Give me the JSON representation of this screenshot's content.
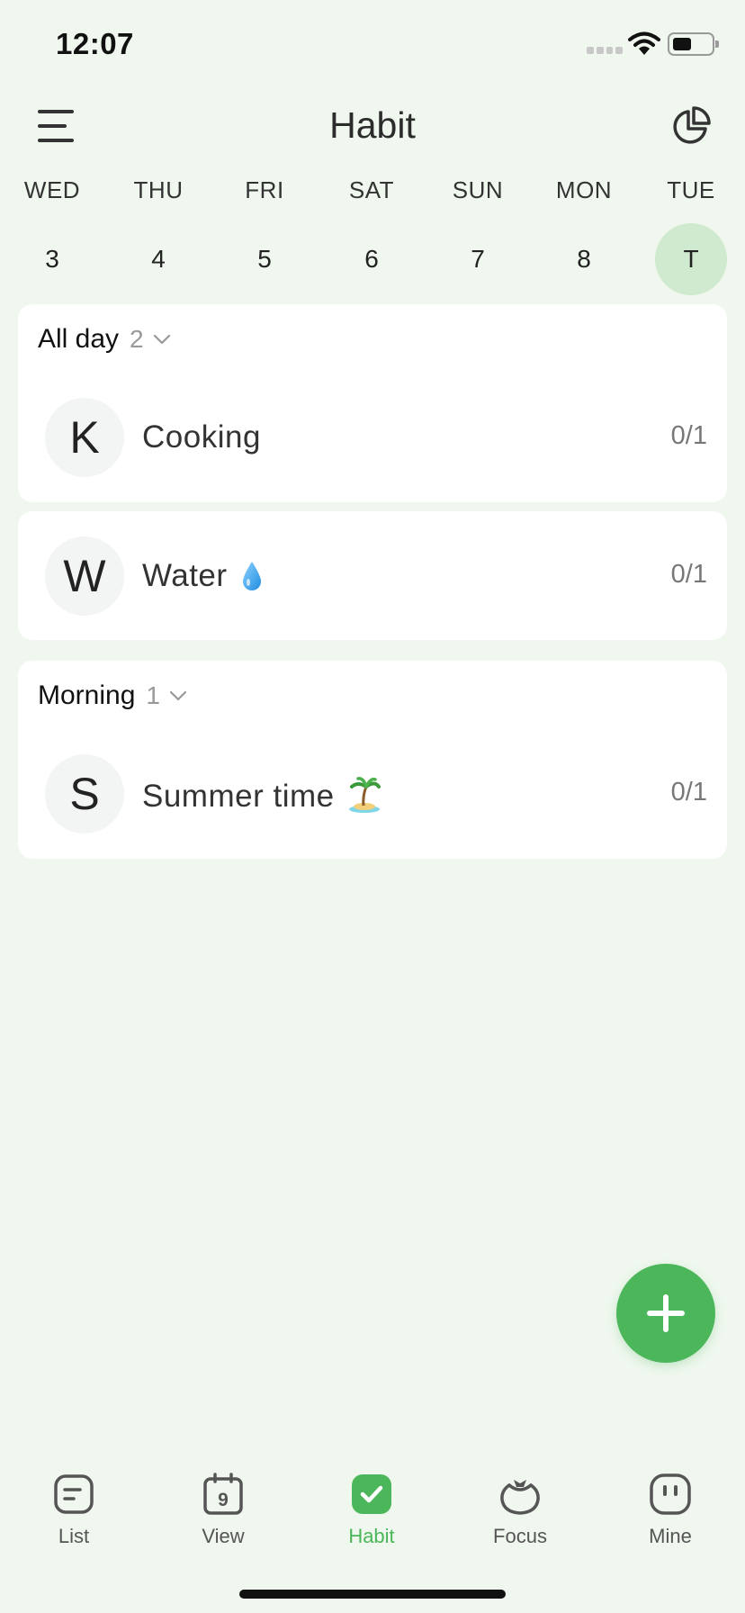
{
  "status_bar": {
    "time": "12:07"
  },
  "header": {
    "title": "Habit"
  },
  "week": {
    "days": [
      {
        "name": "WED",
        "num": "3",
        "selected": false
      },
      {
        "name": "THU",
        "num": "4",
        "selected": false
      },
      {
        "name": "FRI",
        "num": "5",
        "selected": false
      },
      {
        "name": "SAT",
        "num": "6",
        "selected": false
      },
      {
        "name": "SUN",
        "num": "7",
        "selected": false
      },
      {
        "name": "MON",
        "num": "8",
        "selected": false
      },
      {
        "name": "TUE",
        "num": "T",
        "selected": true
      }
    ]
  },
  "sections": [
    {
      "title": "All day",
      "count": "2",
      "habits": [
        {
          "initial": "K",
          "name": "Cooking",
          "progress": "0/1"
        },
        {
          "initial": "W",
          "name": "Water",
          "progress": "0/1",
          "emoji_icon": "water-drop"
        }
      ]
    },
    {
      "title": "Morning",
      "count": "1",
      "habits": [
        {
          "initial": "S",
          "name": "Summer time",
          "progress": "0/1",
          "emoji_icon": "desert-island"
        }
      ]
    }
  ],
  "tabbar": {
    "tabs": [
      {
        "label": "List",
        "icon": "list-icon",
        "active": false
      },
      {
        "label": "View",
        "icon": "calendar-icon",
        "active": false,
        "icon_text": "9"
      },
      {
        "label": "Habit",
        "icon": "habit-check-icon",
        "active": true
      },
      {
        "label": "Focus",
        "icon": "tomato-timer-icon",
        "active": false
      },
      {
        "label": "Mine",
        "icon": "profile-icon",
        "active": false
      }
    ]
  },
  "colors": {
    "accent": "#4cb65a",
    "background": "#eff7ee",
    "selected_day": "#cfeacf"
  }
}
